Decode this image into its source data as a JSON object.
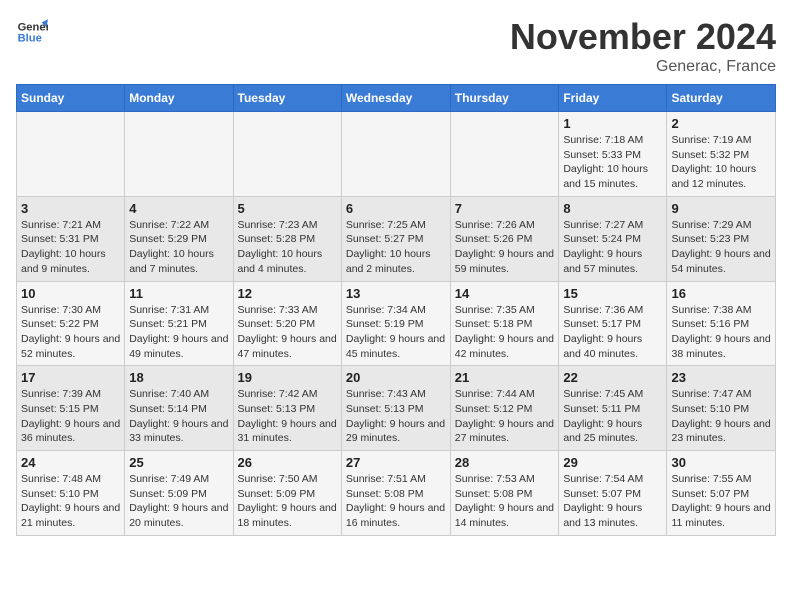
{
  "header": {
    "logo_line1": "General",
    "logo_line2": "Blue",
    "title": "November 2024",
    "subtitle": "Generac, France"
  },
  "columns": [
    "Sunday",
    "Monday",
    "Tuesday",
    "Wednesday",
    "Thursday",
    "Friday",
    "Saturday"
  ],
  "weeks": [
    [
      {
        "day": "",
        "info": ""
      },
      {
        "day": "",
        "info": ""
      },
      {
        "day": "",
        "info": ""
      },
      {
        "day": "",
        "info": ""
      },
      {
        "day": "",
        "info": ""
      },
      {
        "day": "1",
        "info": "Sunrise: 7:18 AM\nSunset: 5:33 PM\nDaylight: 10 hours and 15 minutes."
      },
      {
        "day": "2",
        "info": "Sunrise: 7:19 AM\nSunset: 5:32 PM\nDaylight: 10 hours and 12 minutes."
      }
    ],
    [
      {
        "day": "3",
        "info": "Sunrise: 7:21 AM\nSunset: 5:31 PM\nDaylight: 10 hours and 9 minutes."
      },
      {
        "day": "4",
        "info": "Sunrise: 7:22 AM\nSunset: 5:29 PM\nDaylight: 10 hours and 7 minutes."
      },
      {
        "day": "5",
        "info": "Sunrise: 7:23 AM\nSunset: 5:28 PM\nDaylight: 10 hours and 4 minutes."
      },
      {
        "day": "6",
        "info": "Sunrise: 7:25 AM\nSunset: 5:27 PM\nDaylight: 10 hours and 2 minutes."
      },
      {
        "day": "7",
        "info": "Sunrise: 7:26 AM\nSunset: 5:26 PM\nDaylight: 9 hours and 59 minutes."
      },
      {
        "day": "8",
        "info": "Sunrise: 7:27 AM\nSunset: 5:24 PM\nDaylight: 9 hours and 57 minutes."
      },
      {
        "day": "9",
        "info": "Sunrise: 7:29 AM\nSunset: 5:23 PM\nDaylight: 9 hours and 54 minutes."
      }
    ],
    [
      {
        "day": "10",
        "info": "Sunrise: 7:30 AM\nSunset: 5:22 PM\nDaylight: 9 hours and 52 minutes."
      },
      {
        "day": "11",
        "info": "Sunrise: 7:31 AM\nSunset: 5:21 PM\nDaylight: 9 hours and 49 minutes."
      },
      {
        "day": "12",
        "info": "Sunrise: 7:33 AM\nSunset: 5:20 PM\nDaylight: 9 hours and 47 minutes."
      },
      {
        "day": "13",
        "info": "Sunrise: 7:34 AM\nSunset: 5:19 PM\nDaylight: 9 hours and 45 minutes."
      },
      {
        "day": "14",
        "info": "Sunrise: 7:35 AM\nSunset: 5:18 PM\nDaylight: 9 hours and 42 minutes."
      },
      {
        "day": "15",
        "info": "Sunrise: 7:36 AM\nSunset: 5:17 PM\nDaylight: 9 hours and 40 minutes."
      },
      {
        "day": "16",
        "info": "Sunrise: 7:38 AM\nSunset: 5:16 PM\nDaylight: 9 hours and 38 minutes."
      }
    ],
    [
      {
        "day": "17",
        "info": "Sunrise: 7:39 AM\nSunset: 5:15 PM\nDaylight: 9 hours and 36 minutes."
      },
      {
        "day": "18",
        "info": "Sunrise: 7:40 AM\nSunset: 5:14 PM\nDaylight: 9 hours and 33 minutes."
      },
      {
        "day": "19",
        "info": "Sunrise: 7:42 AM\nSunset: 5:13 PM\nDaylight: 9 hours and 31 minutes."
      },
      {
        "day": "20",
        "info": "Sunrise: 7:43 AM\nSunset: 5:13 PM\nDaylight: 9 hours and 29 minutes."
      },
      {
        "day": "21",
        "info": "Sunrise: 7:44 AM\nSunset: 5:12 PM\nDaylight: 9 hours and 27 minutes."
      },
      {
        "day": "22",
        "info": "Sunrise: 7:45 AM\nSunset: 5:11 PM\nDaylight: 9 hours and 25 minutes."
      },
      {
        "day": "23",
        "info": "Sunrise: 7:47 AM\nSunset: 5:10 PM\nDaylight: 9 hours and 23 minutes."
      }
    ],
    [
      {
        "day": "24",
        "info": "Sunrise: 7:48 AM\nSunset: 5:10 PM\nDaylight: 9 hours and 21 minutes."
      },
      {
        "day": "25",
        "info": "Sunrise: 7:49 AM\nSunset: 5:09 PM\nDaylight: 9 hours and 20 minutes."
      },
      {
        "day": "26",
        "info": "Sunrise: 7:50 AM\nSunset: 5:09 PM\nDaylight: 9 hours and 18 minutes."
      },
      {
        "day": "27",
        "info": "Sunrise: 7:51 AM\nSunset: 5:08 PM\nDaylight: 9 hours and 16 minutes."
      },
      {
        "day": "28",
        "info": "Sunrise: 7:53 AM\nSunset: 5:08 PM\nDaylight: 9 hours and 14 minutes."
      },
      {
        "day": "29",
        "info": "Sunrise: 7:54 AM\nSunset: 5:07 PM\nDaylight: 9 hours and 13 minutes."
      },
      {
        "day": "30",
        "info": "Sunrise: 7:55 AM\nSunset: 5:07 PM\nDaylight: 9 hours and 11 minutes."
      }
    ]
  ]
}
